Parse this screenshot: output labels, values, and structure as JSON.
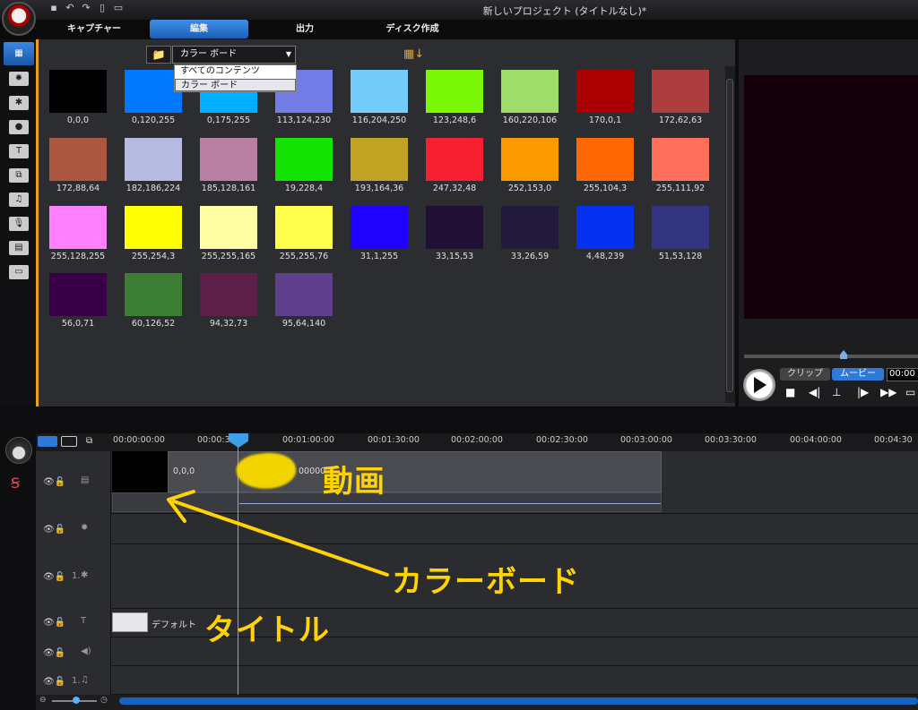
{
  "window": {
    "title": "新しいプロジェクト (タイトルなし)*"
  },
  "tabs": [
    {
      "label": "キャプチャー",
      "active": false
    },
    {
      "label": "編集",
      "active": true
    },
    {
      "label": "出力",
      "active": false
    },
    {
      "label": "ディスク作成",
      "active": false
    }
  ],
  "library": {
    "combo_value": "カラー ボード",
    "dropdown_options": [
      "すべてのコンテンツ",
      "カラー ボード"
    ],
    "swatches": [
      {
        "label": "0,0,0",
        "color": "#000000"
      },
      {
        "label": "0,120,255",
        "color": "#0078ff"
      },
      {
        "label": "0,175,255",
        "color": "#00afff"
      },
      {
        "label": "113,124,230",
        "color": "#717ce6"
      },
      {
        "label": "116,204,250",
        "color": "#74ccfa"
      },
      {
        "label": "123,248,6",
        "color": "#7bf806"
      },
      {
        "label": "160,220,106",
        "color": "#a0dc6a"
      },
      {
        "label": "170,0,1",
        "color": "#aa0001"
      },
      {
        "label": "172,62,63",
        "color": "#ac3e3f"
      },
      {
        "label": "172,88,64",
        "color": "#ac5840"
      },
      {
        "label": "182,186,224",
        "color": "#b6bae0"
      },
      {
        "label": "185,128,161",
        "color": "#b980a1"
      },
      {
        "label": "19,228,4",
        "color": "#13e404"
      },
      {
        "label": "193,164,36",
        "color": "#c1a424"
      },
      {
        "label": "247,32,48",
        "color": "#f72030"
      },
      {
        "label": "252,153,0",
        "color": "#fc9900"
      },
      {
        "label": "255,104,3",
        "color": "#ff6803"
      },
      {
        "label": "255,111,92",
        "color": "#ff6f5c"
      },
      {
        "label": "255,128,255",
        "color": "#ff80ff"
      },
      {
        "label": "255,254,3",
        "color": "#fffe03"
      },
      {
        "label": "255,255,165",
        "color": "#ffffa5"
      },
      {
        "label": "255,255,76",
        "color": "#ffff4c"
      },
      {
        "label": "31,1,255",
        "color": "#1f01ff"
      },
      {
        "label": "33,15,53",
        "color": "#210f35"
      },
      {
        "label": "33,26,59",
        "color": "#211a3b"
      },
      {
        "label": "4,48,239",
        "color": "#0430ef"
      },
      {
        "label": "51,53,128",
        "color": "#333580"
      },
      {
        "label": "56,0,71",
        "color": "#380047"
      },
      {
        "label": "60,126,52",
        "color": "#3c7e34"
      },
      {
        "label": "94,32,73",
        "color": "#5e2049"
      },
      {
        "label": "95,64,140",
        "color": "#5f408c"
      }
    ]
  },
  "preview": {
    "clip_tab": "クリップ",
    "movie_tab": "ムービー",
    "time": "00:00",
    "position": 0.55
  },
  "timeline": {
    "ticks": [
      "00:00:00:00",
      "00:00:3",
      "00:01:00:00",
      "00:01:30:00",
      "00:02:00:00",
      "00:02:30:00",
      "00:03:00:00",
      "00:03:30:00",
      "00:04:00:00",
      "00:04:30"
    ],
    "video_clip_label": "0,0,0",
    "video_clip_number": "00000",
    "title_clip_label": "デフォルト",
    "overlay_track_prefix": "1.",
    "music_track_prefix": "1."
  },
  "annotations": {
    "video": "動画",
    "colorboard": "カラーボード",
    "title": "タイトル"
  }
}
